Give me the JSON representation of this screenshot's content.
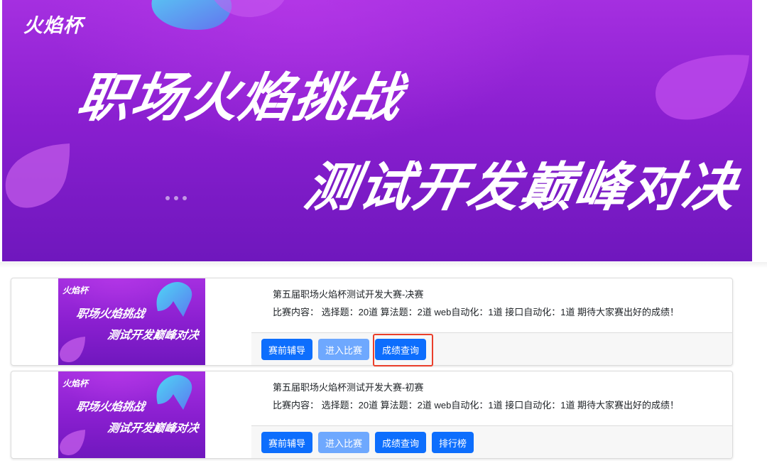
{
  "banner": {
    "brand": "火焰杯",
    "line1": "职场火焰挑战",
    "line2": "测试开发巅峰对决",
    "carousel_dots": 3
  },
  "thumbnail": {
    "brand": "火焰杯",
    "line1": "职场火焰挑战",
    "line2": "测试开发巅峰对决"
  },
  "contests": [
    {
      "title": "第五届职场火焰杯测试开发大赛-决赛",
      "description": "比赛内容：  选择题：20道 算法题：2道 web自动化：1道 接口自动化：1道 期待大家赛出好的成绩！",
      "buttons": {
        "coaching": "赛前辅导",
        "enter": "进入比赛",
        "results": "成绩查询"
      }
    },
    {
      "title": "第五届职场火焰杯测试开发大赛-初赛",
      "description": "比赛内容：  选择题：20道 算法题：2道 web自动化：1道 接口自动化：1道 期待大家赛出好的成绩！",
      "buttons": {
        "coaching": "赛前辅导",
        "enter": "进入比赛",
        "results": "成绩查询",
        "leaderboard": "排行榜"
      }
    }
  ],
  "colors": {
    "primary_button": "#0d6efd",
    "disabled_button": "#6ea8fe",
    "highlight": "#ea3f2b",
    "banner_purple": "#8a1fd0"
  }
}
